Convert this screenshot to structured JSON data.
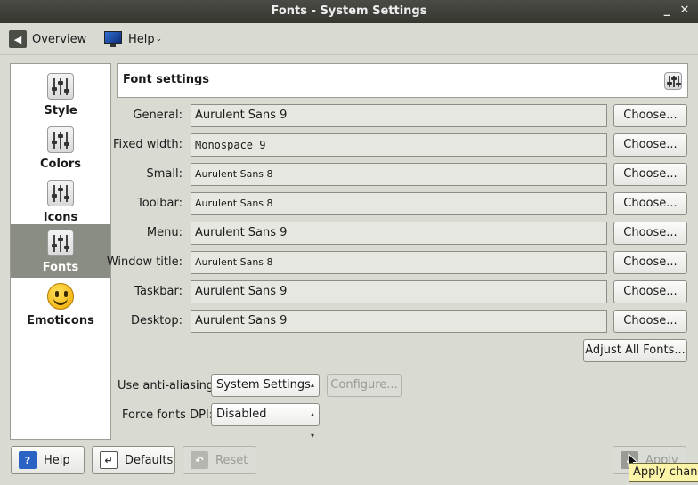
{
  "window": {
    "title": "Fonts - System Settings"
  },
  "toolbar": {
    "overview_label": "Overview",
    "help_label": "Help"
  },
  "sidebar": {
    "items": [
      {
        "label": "Style",
        "icon": "slider-control-icon"
      },
      {
        "label": "Colors",
        "icon": "slider-control-icon"
      },
      {
        "label": "Icons",
        "icon": "slider-control-icon"
      },
      {
        "label": "Fonts",
        "icon": "slider-control-icon",
        "selected": true
      },
      {
        "label": "Emoticons",
        "icon": "smiley-icon"
      }
    ]
  },
  "header": {
    "title": "Font settings"
  },
  "fonts": [
    {
      "label": "General:",
      "value": "Aurulent Sans 9",
      "button": "Choose..."
    },
    {
      "label": "Fixed width:",
      "value": "Monospace 9",
      "button": "Choose..."
    },
    {
      "label": "Small:",
      "value": "Aurulent Sans 8",
      "button": "Choose..."
    },
    {
      "label": "Toolbar:",
      "value": "Aurulent Sans 8",
      "button": "Choose..."
    },
    {
      "label": "Menu:",
      "value": "Aurulent Sans 9",
      "button": "Choose..."
    },
    {
      "label": "Window title:",
      "value": "Aurulent Sans 8",
      "button": "Choose..."
    },
    {
      "label": "Taskbar:",
      "value": "Aurulent Sans 9",
      "button": "Choose..."
    },
    {
      "label": "Desktop:",
      "value": "Aurulent Sans 9",
      "button": "Choose..."
    }
  ],
  "adjust_all_label": "Adjust All Fonts...",
  "antialias": {
    "label": "Use anti-aliasing:",
    "value": "System Settings",
    "configure_label": "Configure..."
  },
  "dpi": {
    "label": "Force fonts DPI:",
    "value": "Disabled"
  },
  "footer": {
    "help_label": "Help",
    "defaults_label": "Defaults",
    "reset_label": "Reset",
    "apply_label": "Apply"
  },
  "tooltip": "Apply chang"
}
